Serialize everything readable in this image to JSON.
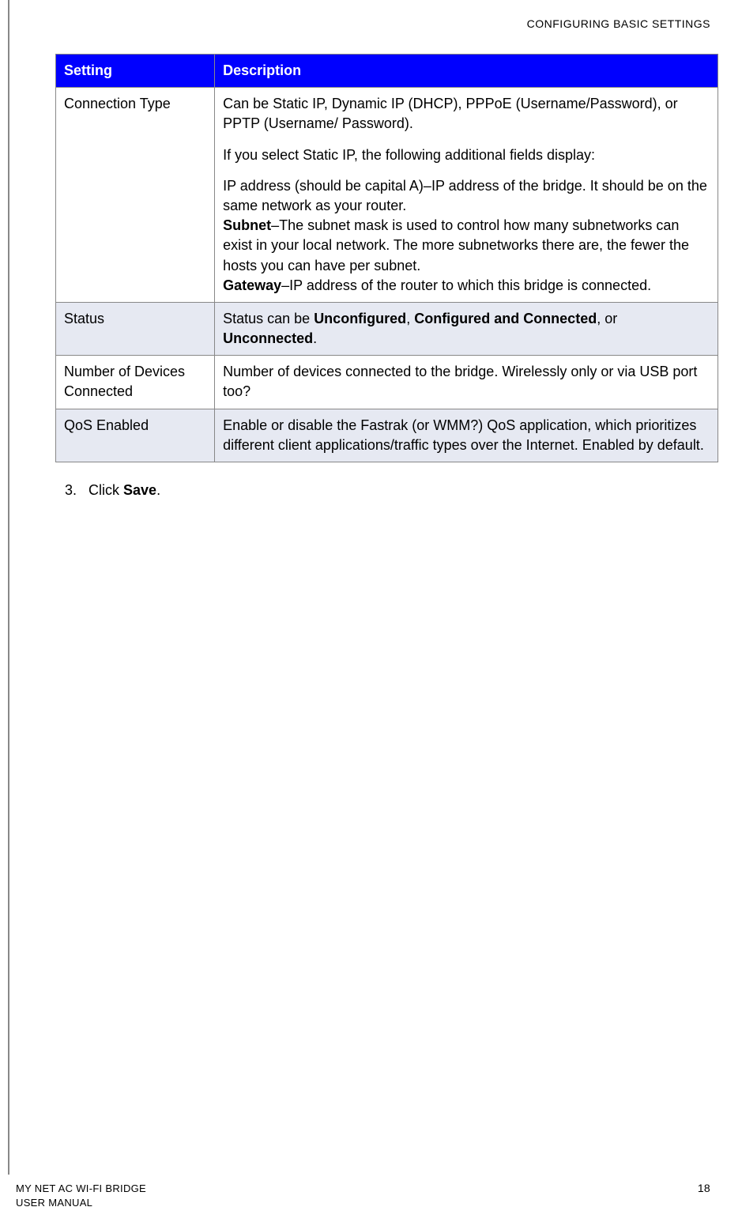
{
  "header": {
    "title": "CONFIGURING BASIC SETTINGS"
  },
  "table": {
    "head": {
      "col1": "Setting",
      "col2": "Description"
    },
    "rows": [
      {
        "setting": "Connection Type",
        "desc": {
          "p1": "Can be Static IP, Dynamic IP (DHCP), PPPoE (Username/Password), or PPTP (Username/ Password).",
          "p2": "If you select Static IP, the following additional fields display:",
          "ip_line": "IP address (should be capital A)–IP address of the bridge. It should be on the same network as your router.",
          "subnet_label": "Subnet",
          "subnet_text": "–The subnet mask is used to control how many subnetworks can exist in your local network. The more subnetworks there are, the fewer the hosts you can have per subnet.",
          "gateway_label": "Gateway",
          "gateway_text": "–IP address of the router to which this bridge is connected."
        }
      },
      {
        "setting": "Status",
        "desc": {
          "pre": "Status can be ",
          "b1": "Unconfigured",
          "mid1": ", ",
          "b2": "Configured and Connected",
          "mid2": ", or ",
          "b3": "Unconnected",
          "post": "."
        }
      },
      {
        "setting": "Number of Devices Connected",
        "desc": {
          "text": "Number of devices connected to the bridge. Wirelessly only or via USB port too?"
        }
      },
      {
        "setting": "QoS Enabled",
        "desc": {
          "text": "Enable or disable the Fastrak (or WMM?) QoS application, which prioritizes different client applications/traffic types over the Internet. Enabled by default."
        }
      }
    ]
  },
  "step": {
    "number": "3.",
    "pre": "Click ",
    "bold": "Save",
    "post": "."
  },
  "footer": {
    "line1": "MY NET AC WI-FI BRIDGE",
    "line2": "USER MANUAL",
    "page": "18"
  }
}
